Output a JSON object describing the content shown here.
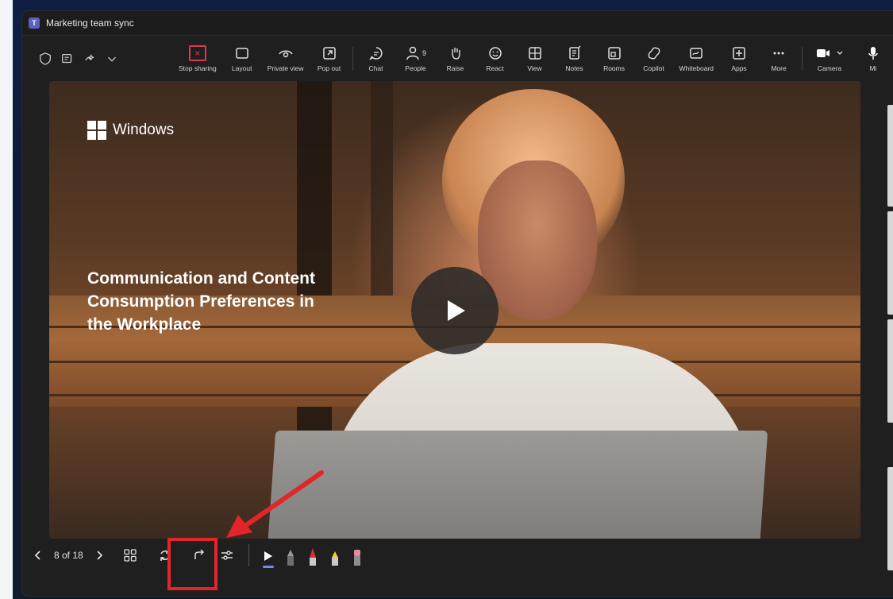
{
  "window": {
    "title": "Marketing team sync"
  },
  "toolbar": {
    "items": [
      {
        "label": "Stop sharing",
        "icon": "stop-sharing-icon"
      },
      {
        "label": "Layout",
        "icon": "layout-icon"
      },
      {
        "label": "Private view",
        "icon": "eye-icon"
      },
      {
        "label": "Pop out",
        "icon": "pop-out-icon"
      },
      {
        "label": "Chat",
        "icon": "chat-icon"
      },
      {
        "label": "People",
        "icon": "people-icon",
        "count": "9"
      },
      {
        "label": "Raise",
        "icon": "hand-icon"
      },
      {
        "label": "React",
        "icon": "smiley-icon"
      },
      {
        "label": "View",
        "icon": "view-grid-icon"
      },
      {
        "label": "Notes",
        "icon": "notes-icon"
      },
      {
        "label": "Rooms",
        "icon": "rooms-icon"
      },
      {
        "label": "Copilot",
        "icon": "copilot-icon"
      },
      {
        "label": "Whiteboard",
        "icon": "whiteboard-icon"
      },
      {
        "label": "Apps",
        "icon": "apps-icon"
      },
      {
        "label": "More",
        "icon": "more-icon"
      },
      {
        "label": "Camera",
        "icon": "camera-icon"
      },
      {
        "label": "Mi",
        "icon": "mic-icon"
      }
    ]
  },
  "slide": {
    "brand": "Windows",
    "title": "Communication and Content Consumption Preferences in the Workplace"
  },
  "presenter_controls": {
    "page": "8 of 18"
  },
  "colors": {
    "accent": "#5b5fc7",
    "stop_red": "#e0384a",
    "annotation_red": "#e4242b",
    "pointer_underline": "#7f85f5"
  }
}
